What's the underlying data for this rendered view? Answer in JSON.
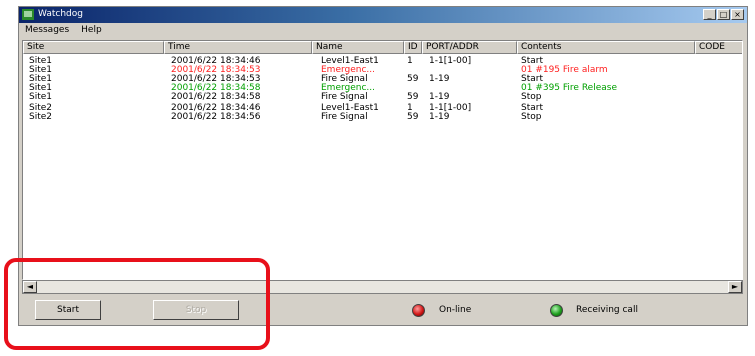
{
  "window": {
    "title": "Watchdog",
    "controls": [
      "_",
      "□",
      "×"
    ]
  },
  "menu": [
    "Messages",
    "Help"
  ],
  "columns": [
    "Site",
    "Time",
    "Name",
    "ID",
    "PORT/ADDR",
    "Contents",
    "CODE"
  ],
  "rows": [
    {
      "site": "Site1",
      "time": "2001/6/22 18:34:46",
      "name": "Level1-East1",
      "id": "1",
      "port": "1-1[1-00]",
      "contents": "Start",
      "color": "#000000"
    },
    {
      "site": "Site1",
      "time": "2001/6/22 18:34:53",
      "name": "Emergenc...",
      "id": "",
      "port": "",
      "contents": "01 #195 Fire alarm",
      "color": "#ff2020"
    },
    {
      "site": "Site1",
      "time": "2001/6/22 18:34:53",
      "name": "Fire Signal",
      "id": "59",
      "port": "1-19",
      "contents": "Start",
      "color": "#000000"
    },
    {
      "site": "Site1",
      "time": "2001/6/22 18:34:58",
      "name": "Emergenc...",
      "id": "",
      "port": "",
      "contents": "01 #395 Fire Release",
      "color": "#00a000"
    },
    {
      "site": "Site1",
      "time": "2001/6/22 18:34:58",
      "name": "Fire Signal",
      "id": "59",
      "port": "1-19",
      "contents": "Stop",
      "color": "#000000"
    },
    {
      "site": "Site2",
      "time": "2001/6/22 18:34:46",
      "name": "Level1-East1",
      "id": "1",
      "port": "1-1[1-00]",
      "contents": "Start",
      "color": "#000000"
    },
    {
      "site": "Site2",
      "time": "2001/6/22 18:34:56",
      "name": "Fire Signal",
      "id": "59",
      "port": "1-19",
      "contents": "Stop",
      "color": "#000000"
    }
  ],
  "scroll": {
    "left": "◄",
    "right": "►"
  },
  "buttons": {
    "start": "Start",
    "stop": "Stop"
  },
  "indicators": [
    {
      "label": "On-line",
      "color": "#d21818"
    },
    {
      "label": "Receiving call",
      "color": "#1fa01f"
    }
  ]
}
